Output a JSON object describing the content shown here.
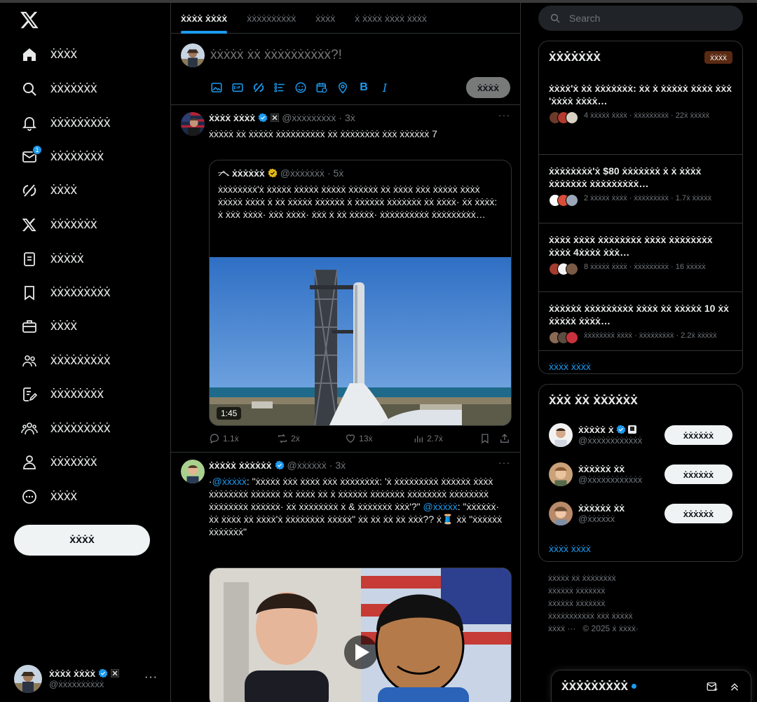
{
  "nav": {
    "items": [
      {
        "key": "home",
        "icon": "home-icon",
        "label": "ẋẋẋẋ"
      },
      {
        "key": "explore",
        "icon": "search-icon",
        "label": "ẋẋẋẋẋẋẋ"
      },
      {
        "key": "notifications",
        "icon": "bell-icon",
        "label": "ẋẋẋẋẋẋẋẋẋ"
      },
      {
        "key": "messages",
        "icon": "mail-icon",
        "label": "ẋẋẋẋẋẋẋẋ",
        "badge": "1"
      },
      {
        "key": "grok",
        "icon": "grok-icon",
        "label": "ẋẋẋẋ"
      },
      {
        "key": "premium",
        "icon": "x-logo-icon",
        "label": "ẋẋẋẋẋẋẋ"
      },
      {
        "key": "lists",
        "icon": "list-icon",
        "label": "ẋẋẋẋẋ"
      },
      {
        "key": "bookmarks",
        "icon": "bookmark-icon",
        "label": "ẋẋẋẋẋẋẋẋẋ"
      },
      {
        "key": "jobs",
        "icon": "briefcase-icon",
        "label": "ẋẋẋẋ"
      },
      {
        "key": "communities",
        "icon": "communities-icon",
        "label": "ẋẋẋẋẋẋẋẋẋ"
      },
      {
        "key": "articles",
        "icon": "edit-document-icon",
        "label": "ẋẋẋẋẋẋẋẋ"
      },
      {
        "key": "organizations",
        "icon": "people-icon",
        "label": "ẋẋẋẋẋẋẋẋẋ"
      },
      {
        "key": "profile",
        "icon": "person-icon",
        "label": "ẋẋẋẋẋẋẋ"
      },
      {
        "key": "more",
        "icon": "more-circle-icon",
        "label": "ẋẋẋẋ"
      }
    ],
    "post_label": "ẋẋẋẋ",
    "account": {
      "name": "ẋẋẋẋ ẋẋẋẋ",
      "handle": "@ẋẋẋẋẋẋẋẋẋẋ"
    }
  },
  "tabs": [
    "ẋẋẋẋ ẋẋẋẋ",
    "ẋẋẋẋẋẋẋẋẋẋ",
    "ẋẋẋẋ",
    "ẋ ẋẋẋẋ ẋẋẋẋ ẋẋẋẋ"
  ],
  "composer": {
    "placeholder": "ẋẋẋẋẋ ẋẋ ẋẋẋẋẋẋẋẋẋẋ?!",
    "post_label": "ẋẋẋẋ"
  },
  "tweets": [
    {
      "name": "ẋẋẋẋ ẋẋẋẋ",
      "handle": "@ẋẋẋẋẋẋẋẋẋ",
      "time": "· 3ẋ",
      "text": "ẋẋẋẋẋ ẋẋ ẋẋẋẋẋ ẋẋẋẋẋẋẋẋẋẋ ẋẋ ẋẋẋẋẋẋẋẋ ẋẋẋ ẋẋẋẋẋẋ 7",
      "quote": {
        "name": "ẋẋẋẋẋẋ",
        "handle": "@ẋẋẋẋẋẋẋ",
        "time": "· 5ẋ",
        "text": "ẋẋẋẋẋẋẋẋ'ẋ ẋẋẋẋẋ ẋẋẋẋẋ ẋẋẋẋẋ ẋẋẋẋẋẋ ẋẋ ẋẋẋẋ ẋẋẋ ẋẋẋẋẋ ẋẋẋẋ ẋẋẋẋẋ ẋẋẋẋ ẋ ẋẋ ẋẋẋẋẋ ẋẋẋẋẋẋ ẋ ẋẋẋẋẋẋ ẋẋẋẋẋẋẋ ẋẋ ẋẋẋẋ· ẋẋ ẋẋẋẋ: ẋ ẋẋẋ ẋẋẋẋ· ẋẋẋ ẋẋẋẋ· ẋẋẋ ẋ ẋẋ ẋẋẋẋẋ· ẋẋẋẋẋẋẋẋẋẋ ẋẋẋẋẋẋẋẋẋ…",
        "duration": "1:45"
      },
      "stats": {
        "replies": "1.1ẋ",
        "reposts": "2ẋ",
        "likes": "13ẋ",
        "views": "2.7ẋ"
      }
    },
    {
      "name": "ẋẋẋẋẋ ẋẋẋẋẋẋ",
      "handle": "@ẋẋẋẋẋẋ",
      "time": "· 3ẋ",
      "text_pre": "·",
      "mention1": "@ẋẋẋẋẋ",
      "text_mid": ": \"ẋẋẋẋẋ ẋẋẋ ẋẋẋẋ ẋẋẋ ẋẋẋẋẋẋẋẋ: 'ẋ ẋẋẋẋẋẋẋẋẋ ẋẋẋẋẋẋ ẋẋẋẋ ẋẋẋẋẋẋẋẋ ẋẋẋẋẋẋ ẋẋ ẋẋẋẋ ẋẋ ẋ ẋẋẋẋẋẋ ẋẋẋẋẋẋẋ ẋẋẋẋẋẋẋẋ ẋẋẋẋẋẋẋẋ ẋẋẋẋẋẋẋẋ ẋẋẋẋẋẋ· ẋẋ ẋẋẋẋẋẋẋẋ ẋ & ẋẋẋẋẋẋẋ ẋẋẋ'?\"",
      "mention2": "@ẋẋẋẋẋ",
      "text_post": ": \"ẋẋẋẋẋẋ· ẋẋ ẋẋẋẋ ẋẋ ẋẋẋẋ'ẋ ẋẋẋẋẋẋẋẋ ẋẋẋẋẋ\" ẋẋ ẋẋ ẋẋ ẋẋ ẋẋẋ?? ẋ🧵 ẋẋ \"ẋẋẋẋẋẋ ẋẋẋẋẋẋẋ\""
    }
  ],
  "search": {
    "placeholder": "Search"
  },
  "news_panel": {
    "title": "ẋẋẋẋẋẋẋ",
    "badge": "ẋẋẋẋ",
    "items": [
      {
        "title": "ẋẋẋẋ'ẋ ẋẋ ẋẋẋẋẋẋẋ: ẋẋ ẋ ẋẋẋẋẋ ẋẋẋẋ ẋẋẋ 'ẋẋẋẋ ẋẋẋẋ…",
        "meta": "4 ẋẋẋẋẋ ẋẋẋẋ · ẋẋẋẋẋẋẋẋẋ · 22ẋ ẋẋẋẋẋ",
        "faces": [
          "#6b3a2a",
          "#b23a2e",
          "#d9d2c3"
        ]
      },
      {
        "title": "ẋẋẋẋẋẋẋẋ'ẋ $80 ẋẋẋẋẋẋẋ ẋ ẋ ẋẋẋẋ ẋẋẋẋẋẋẋ ẋẋẋẋẋẋẋẋẋ…",
        "meta": "2 ẋẋẋẋẋ ẋẋẋẋ · ẋẋẋẋẋẋẋẋẋ · 1.7ẋ ẋẋẋẋẋ",
        "faces": [
          "#ffffff",
          "#d94c3a",
          "#9aa7b8"
        ]
      },
      {
        "title": "ẋẋẋẋ ẋẋẋẋ ẋẋẋẋẋẋẋẋ ẋẋẋẋ ẋẋẋẋẋẋẋẋ ẋẋẋẋ 4ẋẋẋẋ ẋẋẋ…",
        "meta": "8 ẋẋẋẋẋ ẋẋẋẋ · ẋẋẋẋẋẋẋẋẋ · 16 ẋẋẋẋẋ",
        "faces": [
          "#a33b2e",
          "#f3f3f3",
          "#7a5a45"
        ]
      },
      {
        "title": "ẋẋẋẋẋẋ ẋẋẋẋẋẋẋẋẋ ẋẋẋẋ ẋẋ ẋẋẋẋẋ 10 ẋẋ ẋẋẋẋẋ ẋẋẋẋ…",
        "meta": "ẋẋẋẋẋẋẋẋ ẋẋẋẋ · ẋẋẋẋẋẋẋẋẋ · 2.2ẋ ẋẋẋẋẋ",
        "faces": [
          "#8a6a55",
          "#5b4d3f",
          "#c9323b"
        ]
      }
    ],
    "show_more": "ẋẋẋẋ ẋẋẋẋ"
  },
  "follow_panel": {
    "title": "ẋẋẋ ẋẋ ẋẋẋẋẋẋ",
    "items": [
      {
        "name": "ẋẋẋẋẋ ẋ",
        "handle": "@ẋẋẋẋẋẋẋẋẋẋẋẋ",
        "button": "ẋẋẋẋẋẋ",
        "avatar_color": "#f2f2f2"
      },
      {
        "name": "ẋẋẋẋẋẋ ẋẋ",
        "handle": "@ẋẋẋẋẋẋẋẋẋẋẋẋ",
        "button": "ẋẋẋẋẋẋ",
        "avatar_color": "#c9a27a"
      },
      {
        "name": "ẋẋẋẋẋẋ ẋẋ",
        "handle": "@ẋẋẋẋẋẋ",
        "button": "ẋẋẋẋẋẋ",
        "avatar_color": "#b88a6a"
      }
    ],
    "show_more": "ẋẋẋẋ ẋẋẋẋ"
  },
  "footer": {
    "line1": "ẋẋẋẋẋ ẋẋ ẋẋẋẋẋẋẋẋ",
    "line2": "ẋẋẋẋẋẋ ẋẋẋẋẋẋẋ",
    "line3": "ẋẋẋẋẋẋ ẋẋẋẋẋẋẋ",
    "line4": "ẋẋẋẋẋẋẋẋẋẋẋ ẋẋẋ ẋẋẋẋẋ",
    "more": "ẋẋẋẋ ···",
    "copyright": "© 2025 ẋ ẋẋẋẋ·"
  },
  "messages_dock": {
    "title": "ẋẋẋẋẋẋẋẋẋ"
  },
  "colors": {
    "accent": "#1d9bf0",
    "background": "#000000",
    "border": "#2f3336"
  }
}
